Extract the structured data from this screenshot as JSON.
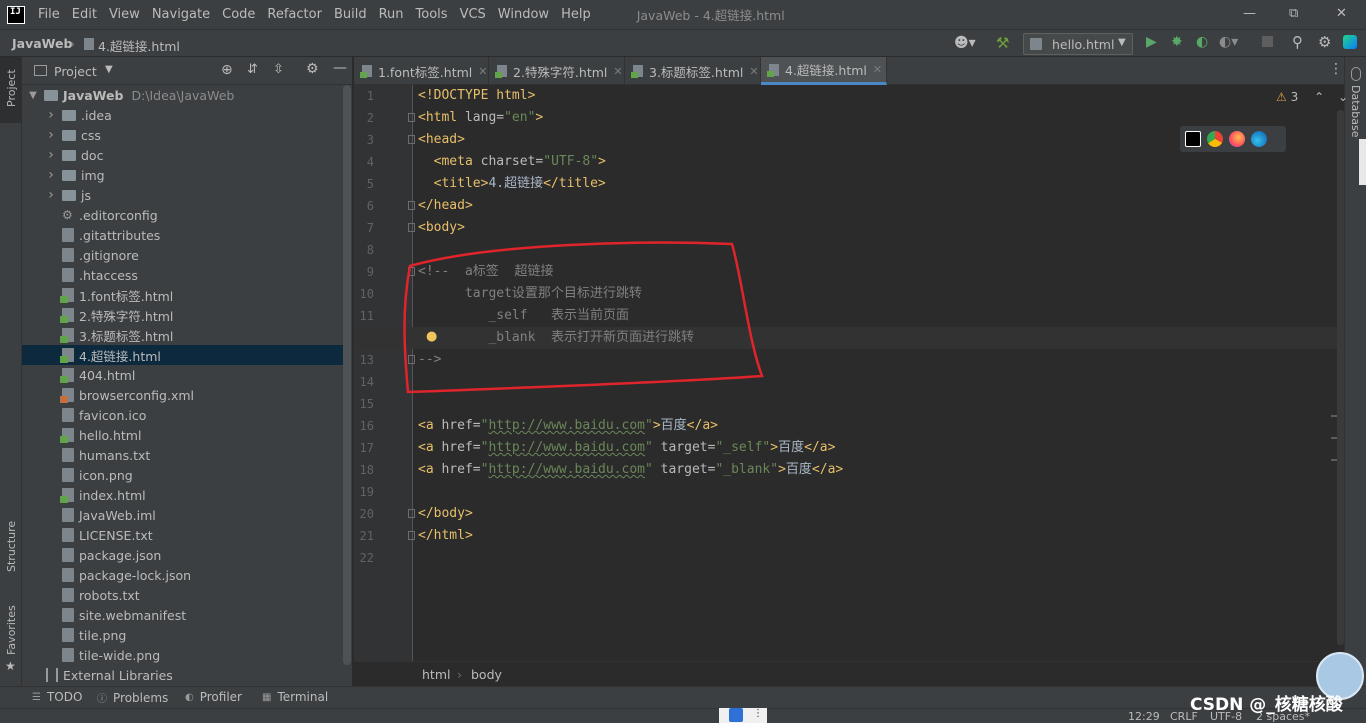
{
  "menubar": {
    "items": [
      "File",
      "Edit",
      "View",
      "Navigate",
      "Code",
      "Refactor",
      "Build",
      "Run",
      "Tools",
      "VCS",
      "Window",
      "Help"
    ],
    "window_title": "JavaWeb - 4.超链接.html"
  },
  "navbar": {
    "project": "JavaWeb",
    "file": "4.超链接.html",
    "run_config": "hello.html"
  },
  "project_panel": {
    "title": "Project",
    "root_name": "JavaWeb",
    "root_path": "D:\\Idea\\JavaWeb",
    "items": [
      {
        "label": ".idea",
        "kind": "folder"
      },
      {
        "label": "css",
        "kind": "folder"
      },
      {
        "label": "doc",
        "kind": "folder"
      },
      {
        "label": "img",
        "kind": "folder"
      },
      {
        "label": "js",
        "kind": "folder"
      },
      {
        "label": ".editorconfig",
        "kind": "gear"
      },
      {
        "label": ".gitattributes",
        "kind": "doc"
      },
      {
        "label": ".gitignore",
        "kind": "doc"
      },
      {
        "label": ".htaccess",
        "kind": "doc"
      },
      {
        "label": "1.font标签.html",
        "kind": "html"
      },
      {
        "label": "2.特殊字符.html",
        "kind": "html"
      },
      {
        "label": "3.标题标签.html",
        "kind": "html"
      },
      {
        "label": "4.超链接.html",
        "kind": "html"
      },
      {
        "label": "404.html",
        "kind": "html"
      },
      {
        "label": "browserconfig.xml",
        "kind": "xml"
      },
      {
        "label": "favicon.ico",
        "kind": "doc"
      },
      {
        "label": "hello.html",
        "kind": "html"
      },
      {
        "label": "humans.txt",
        "kind": "doc"
      },
      {
        "label": "icon.png",
        "kind": "doc"
      },
      {
        "label": "index.html",
        "kind": "html"
      },
      {
        "label": "JavaWeb.iml",
        "kind": "doc"
      },
      {
        "label": "LICENSE.txt",
        "kind": "doc"
      },
      {
        "label": "package.json",
        "kind": "doc"
      },
      {
        "label": "package-lock.json",
        "kind": "doc"
      },
      {
        "label": "robots.txt",
        "kind": "doc"
      },
      {
        "label": "site.webmanifest",
        "kind": "doc"
      },
      {
        "label": "tile.png",
        "kind": "doc"
      },
      {
        "label": "tile-wide.png",
        "kind": "doc"
      }
    ],
    "external_libraries": "External Libraries"
  },
  "tabs": [
    "1.font标签.html",
    "2.特殊字符.html",
    "3.标题标签.html",
    "4.超链接.html"
  ],
  "active_tab": "4.超链接.html",
  "editor": {
    "warning_count": "3",
    "line_numbers": [
      "1",
      "2",
      "3",
      "4",
      "5",
      "6",
      "7",
      "8",
      "9",
      "10",
      "11",
      "12",
      "13",
      "14",
      "15",
      "16",
      "17",
      "18",
      "19",
      "20",
      "21",
      "22"
    ],
    "current_line": "12",
    "code": {
      "l1": "<!DOCTYPE html>",
      "l2a": "<html ",
      "l2b": "lang=",
      "l2c": "\"en\"",
      "l2d": ">",
      "l3": "<head>",
      "l4a": "  <meta ",
      "l4b": "charset=",
      "l4c": "\"UTF-8\"",
      "l4d": ">",
      "l5a": "  <title>",
      "l5b": "4.超链接",
      "l5c": "</title>",
      "l6": "</head>",
      "l7": "<body>",
      "l9": "<!--  a标签  超链接",
      "l10": "      target设置那个目标进行跳转",
      "l11": "         _self   表示当前页面",
      "l12": "         _blank  表示打开新页面进行跳转",
      "l13": "-->",
      "a_open": "<a ",
      "href": "href=",
      "q": "\"",
      "url": "http://www.baidu.com",
      "close_gt": ">",
      "target": " target=",
      "self_val": "\"_self\"",
      "blank_val": "\"_blank\"",
      "link_text": "百度",
      "a_close": "</a>",
      "l20": "</body>",
      "l21": "</html>"
    }
  },
  "breadcrumbs": [
    "html",
    "body"
  ],
  "side_tools": {
    "left_top": "Project",
    "left_structure": "Structure",
    "left_favorites": "Favorites",
    "right": "Database"
  },
  "bottom_tools": [
    "TODO",
    "Problems",
    "Profiler",
    "Terminal"
  ],
  "status": {
    "position": "12:29",
    "line_sep": "CRLF",
    "encoding": "UTF-8",
    "indent": "2 spaces*"
  },
  "watermark": "CSDN @_核糖核酸"
}
